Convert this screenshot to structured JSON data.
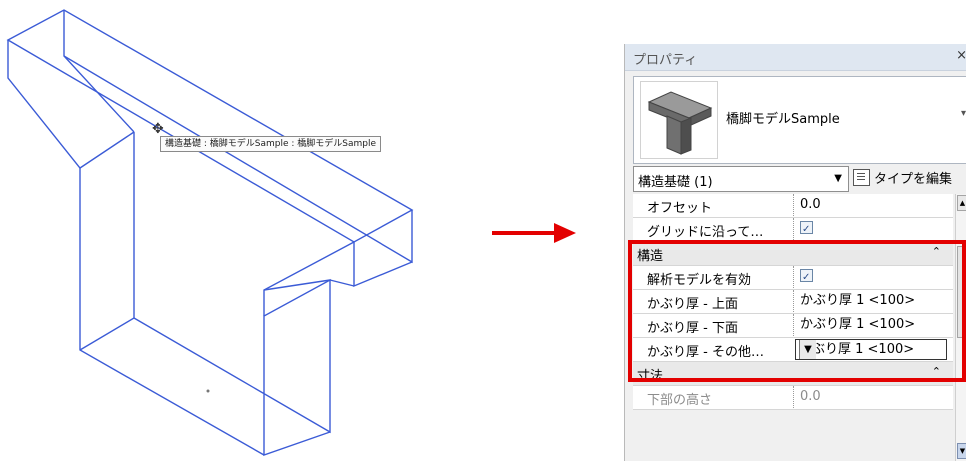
{
  "viewport": {
    "tooltip": "構造基礎 : 橋脚モデルSample : 橋脚モデルSample",
    "model_color": "#3b5bd6"
  },
  "arrow_color": "#e30000",
  "highlight_color": "#e30000",
  "properties": {
    "title": "プロパティ",
    "close": "×",
    "type_name": "橋脚モデルSample",
    "type_caret": "▾",
    "category_select": "構造基礎 (1)",
    "edit_type_label": "タイプを編集",
    "rows": [
      {
        "label": "オフセット",
        "value": "0.0"
      },
      {
        "label": "グリッドに沿って…",
        "value": ""
      }
    ],
    "group_structure": {
      "label": "構造",
      "chevron": "⌃"
    },
    "structure_rows": [
      {
        "label": "解析モデルを有効",
        "value": ""
      },
      {
        "label": "かぶり厚 - 上面",
        "value": "かぶり厚 1 <100>"
      },
      {
        "label": "かぶり厚 - 下面",
        "value": "かぶり厚 1 <100>"
      },
      {
        "label": "かぶり厚 - その他…",
        "value": "かぶり厚 1 <100>"
      }
    ],
    "group_dimensions": {
      "label": "寸法",
      "chevron": "⌃"
    },
    "dimension_rows": [
      {
        "label": "下部の高さ",
        "value": "0.0"
      }
    ]
  }
}
